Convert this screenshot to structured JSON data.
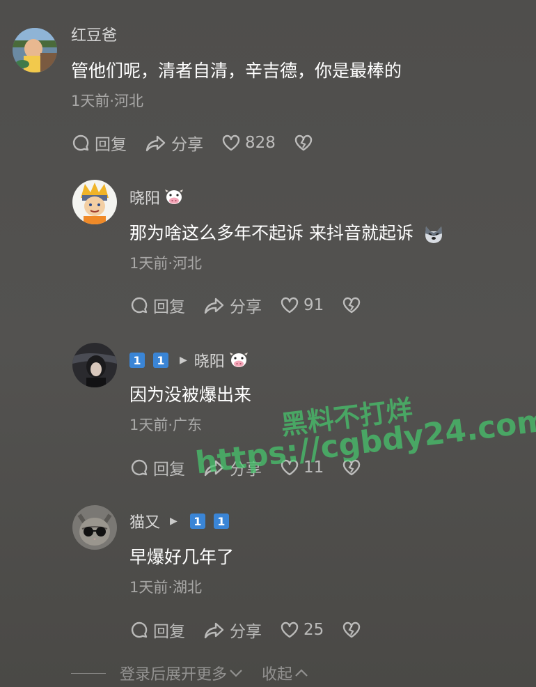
{
  "comments": [
    {
      "username": "红豆爸",
      "text": "管他们呢，清者自清，辛吉德，你是最棒的",
      "meta": "1天前·河北",
      "reply_label": "回复",
      "share_label": "分享",
      "likes": "828"
    },
    {
      "username": "晓阳",
      "text": "那为啥这么多年不起诉 来抖音就起诉",
      "meta": "1天前·河北",
      "reply_label": "回复",
      "share_label": "分享",
      "likes": "91"
    },
    {
      "username_badges": [
        "1",
        "1"
      ],
      "reply_to": "晓阳",
      "text": "因为没被爆出来",
      "meta": "1天前·广东",
      "reply_label": "回复",
      "share_label": "分享",
      "likes": "11"
    },
    {
      "username": "猫又",
      "reply_to_badges": [
        "1",
        "1"
      ],
      "text": "早爆好几年了",
      "meta": "1天前·湖北",
      "reply_label": "回复",
      "share_label": "分享",
      "likes": "25"
    }
  ],
  "footer": {
    "expand_label": "登录后展开更多",
    "collapse_label": "收起"
  },
  "watermark": {
    "line1": "黑料不打烊",
    "line2": "https://cgbdy24.com"
  },
  "icons": {
    "reply": "speech-bubble-icon",
    "share": "share-arrow-icon",
    "like": "heart-icon",
    "dislike": "broken-heart-icon",
    "badge": "cow-emoji-icon"
  },
  "colors": {
    "background": "#4f4e4c",
    "badge_blue": "#3a85d6",
    "watermark_green": "#46c86e"
  }
}
